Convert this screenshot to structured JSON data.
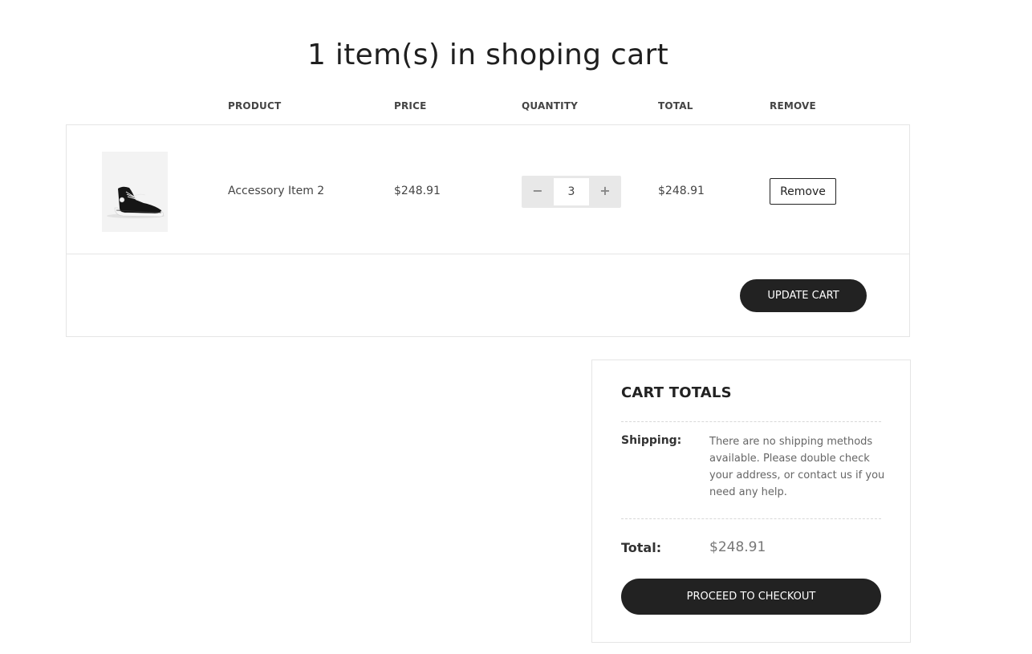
{
  "page": {
    "title": "1 item(s) in shoping cart"
  },
  "table": {
    "headers": {
      "product": "PRODUCT",
      "price": "PRICE",
      "quantity": "QUANTITY",
      "total": "TOTAL",
      "remove": "REMOVE"
    },
    "items": [
      {
        "image_icon": "sneaker-image",
        "name": "Accessory Item 2",
        "price": "$248.91",
        "quantity": "3",
        "total": "$248.91",
        "remove_label": "Remove"
      }
    ],
    "qty_minus": "−",
    "qty_plus": "+",
    "update_label": "UPDATE CART"
  },
  "totals": {
    "title": "CART TOTALS",
    "shipping_label": "Shipping:",
    "shipping_text": "There are no shipping methods available. Please double check your address, or contact us if you need any help.",
    "total_label": "Total:",
    "total_value": "$248.91",
    "checkout_label": "PROCEED TO CHECKOUT"
  },
  "colors": {
    "button_dark": "#222222",
    "border": "#e5e5e5",
    "qty_bg": "#e8e8e8"
  }
}
